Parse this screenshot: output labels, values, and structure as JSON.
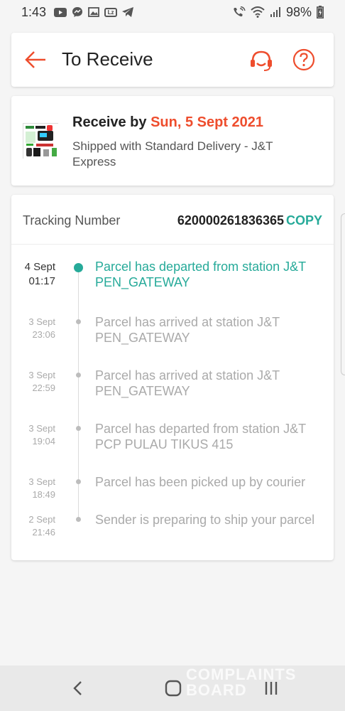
{
  "status_bar": {
    "time": "1:43",
    "battery": "98%",
    "left_icons": [
      "youtube-icon",
      "messenger-icon",
      "image-icon",
      "lazada-icon",
      "telegram-icon"
    ],
    "lazada_text": "Lz",
    "right_icons": [
      "wifi-calling-icon",
      "wifi-icon",
      "signal-icon",
      "battery-icon"
    ]
  },
  "header": {
    "title": "To Receive",
    "accent_color": "#ee4d2d"
  },
  "delivery": {
    "receive_prefix": "Receive by",
    "receive_date": "Sun, 5 Sept 2021",
    "shipped_text": "Shipped with Standard Delivery  - J&T Express"
  },
  "tracking": {
    "label": "Tracking Number",
    "number": "620000261836365",
    "copy_label": "COPY",
    "highlight_color": "#26aa99",
    "events": [
      {
        "date": "4 Sept",
        "time": "01:17",
        "description": "Parcel has departed from station J&T PEN_GATEWAY",
        "current": true
      },
      {
        "date": "3 Sept",
        "time": "23:06",
        "description": "Parcel has arrived at station J&T PEN_GATEWAY",
        "current": false
      },
      {
        "date": "3 Sept",
        "time": "22:59",
        "description": "Parcel has arrived at station J&T PEN_GATEWAY",
        "current": false
      },
      {
        "date": "3 Sept",
        "time": "19:04",
        "description": "Parcel has departed from station J&T PCP PULAU TIKUS 415",
        "current": false
      },
      {
        "date": "3 Sept",
        "time": "18:49",
        "description": "Parcel has been picked up by courier",
        "current": false
      },
      {
        "date": "2 Sept",
        "time": "21:46",
        "description": "Sender is preparing to ship your parcel",
        "current": false
      }
    ]
  },
  "watermark": {
    "line1": "COMPLAINTS",
    "line2": "BOARD"
  }
}
